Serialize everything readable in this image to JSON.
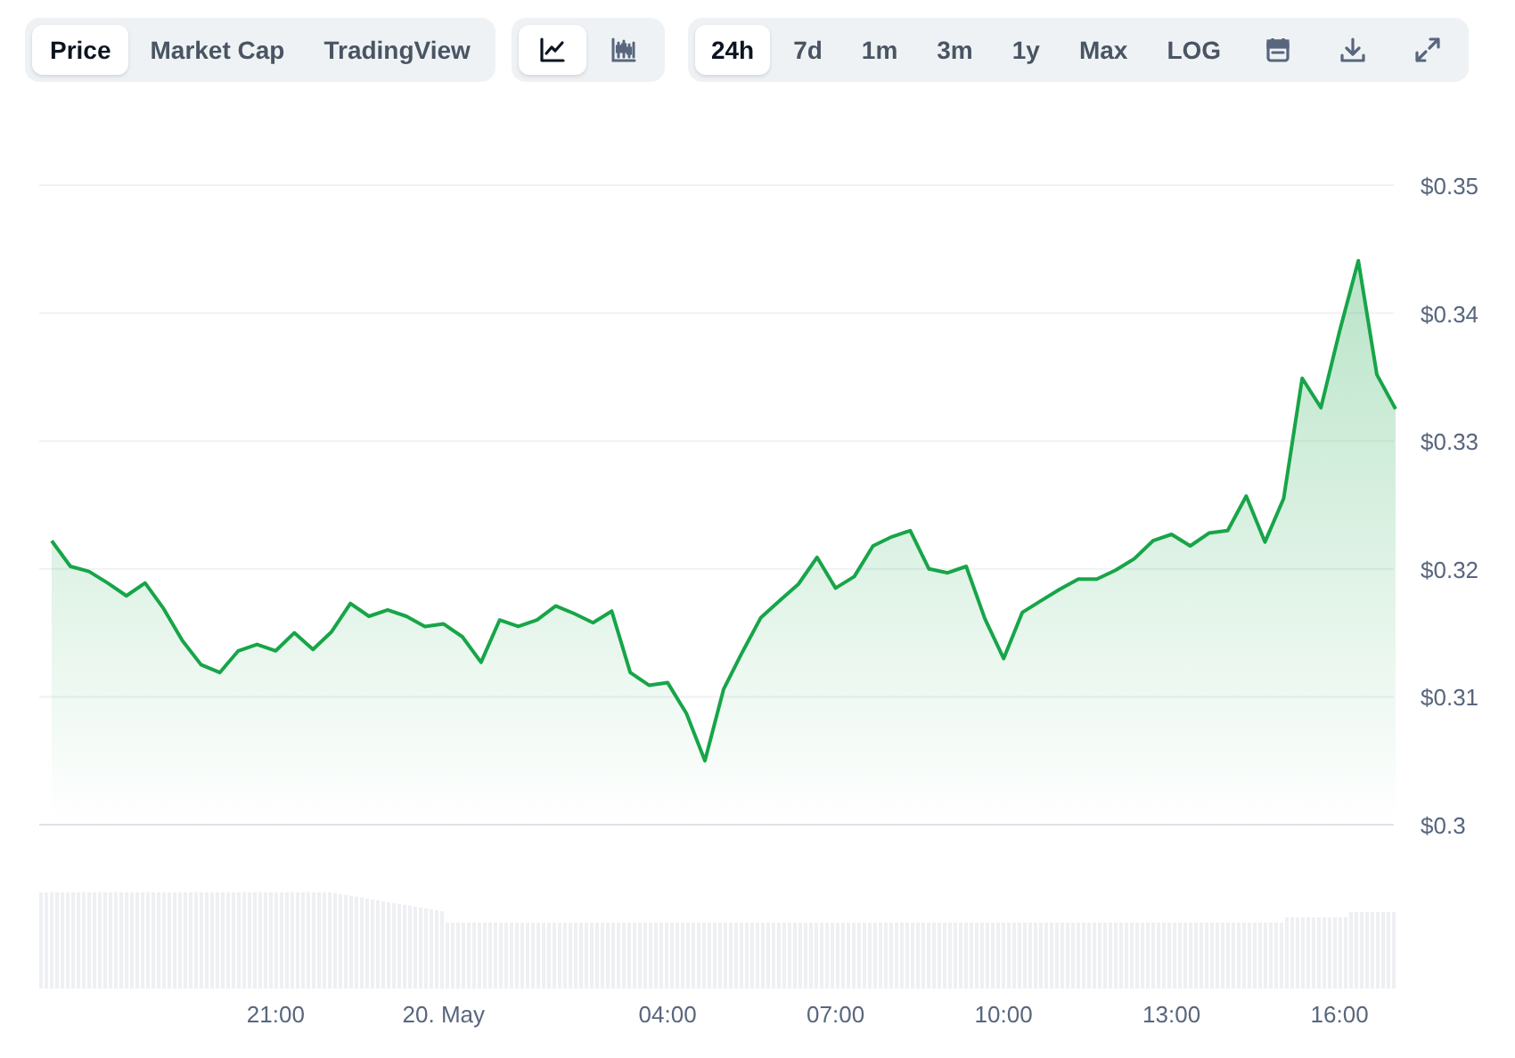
{
  "view_tabs": [
    {
      "label": "Price",
      "selected": true
    },
    {
      "label": "Market Cap",
      "selected": false
    },
    {
      "label": "TradingView",
      "selected": false
    }
  ],
  "chart_type_buttons": [
    {
      "kind": "line",
      "selected": true
    },
    {
      "kind": "candlestick",
      "selected": false
    }
  ],
  "range_tabs": [
    {
      "label": "24h",
      "selected": true
    },
    {
      "label": "7d",
      "selected": false
    },
    {
      "label": "1m",
      "selected": false
    },
    {
      "label": "3m",
      "selected": false
    },
    {
      "label": "1y",
      "selected": false
    },
    {
      "label": "Max",
      "selected": false
    }
  ],
  "log_toggle": {
    "label": "LOG",
    "on": false
  },
  "tool_buttons": [
    {
      "kind": "calendar"
    },
    {
      "kind": "download"
    },
    {
      "kind": "expand"
    }
  ],
  "price_chart": {
    "chart_data": {
      "type": "area",
      "grid": true,
      "categories": [
        null,
        null,
        null,
        null,
        null,
        null,
        null,
        null,
        null,
        null,
        null,
        null,
        "21:00",
        null,
        null,
        null,
        null,
        null,
        null,
        null,
        null,
        "20. May",
        null,
        null,
        null,
        null,
        null,
        null,
        null,
        null,
        null,
        null,
        null,
        "04:00",
        null,
        null,
        null,
        null,
        null,
        null,
        null,
        null,
        "07:00",
        null,
        null,
        null,
        null,
        null,
        null,
        null,
        null,
        "10:00",
        null,
        null,
        null,
        null,
        null,
        null,
        null,
        null,
        "13:00",
        null,
        null,
        null,
        null,
        null,
        null,
        null,
        null,
        "16:00",
        null,
        null,
        null
      ],
      "series": [
        {
          "color": "#17a548",
          "values": [
            0.3222,
            0.3202,
            0.3198,
            0.3189,
            0.3179,
            0.3189,
            0.3169,
            0.3144,
            0.3125,
            0.3119,
            0.3136,
            0.3141,
            0.3136,
            0.315,
            0.3137,
            0.3151,
            0.3173,
            0.3163,
            0.3168,
            0.3163,
            0.3155,
            0.3157,
            0.3147,
            0.3127,
            0.316,
            0.3155,
            0.316,
            0.3171,
            0.3165,
            0.3158,
            0.3167,
            0.3119,
            0.3109,
            0.3111,
            0.3087,
            0.305,
            0.3106,
            0.3135,
            0.3162,
            0.3175,
            0.3188,
            0.3209,
            0.3185,
            0.3194,
            0.3218,
            0.3225,
            0.323,
            0.32,
            0.3197,
            0.3202,
            0.3161,
            0.313,
            0.3166,
            0.3175,
            0.3184,
            0.3192,
            0.3192,
            0.3199,
            0.3208,
            0.3222,
            0.3227,
            0.3218,
            0.3228,
            0.323,
            0.3257,
            0.3221,
            0.3255,
            0.3349,
            0.3326,
            0.3386,
            0.3441,
            0.3352,
            0.3325
          ]
        }
      ],
      "ylim": [
        0.3,
        0.35
      ],
      "yticks": [
        {
          "value": 0.35,
          "label": "$0.35"
        },
        {
          "value": 0.34,
          "label": "$0.34"
        },
        {
          "value": 0.33,
          "label": "$0.33"
        },
        {
          "value": 0.32,
          "label": "$0.32"
        },
        {
          "value": 0.31,
          "label": "$0.31"
        },
        {
          "value": 0.3,
          "label": "$0.3"
        }
      ]
    }
  }
}
